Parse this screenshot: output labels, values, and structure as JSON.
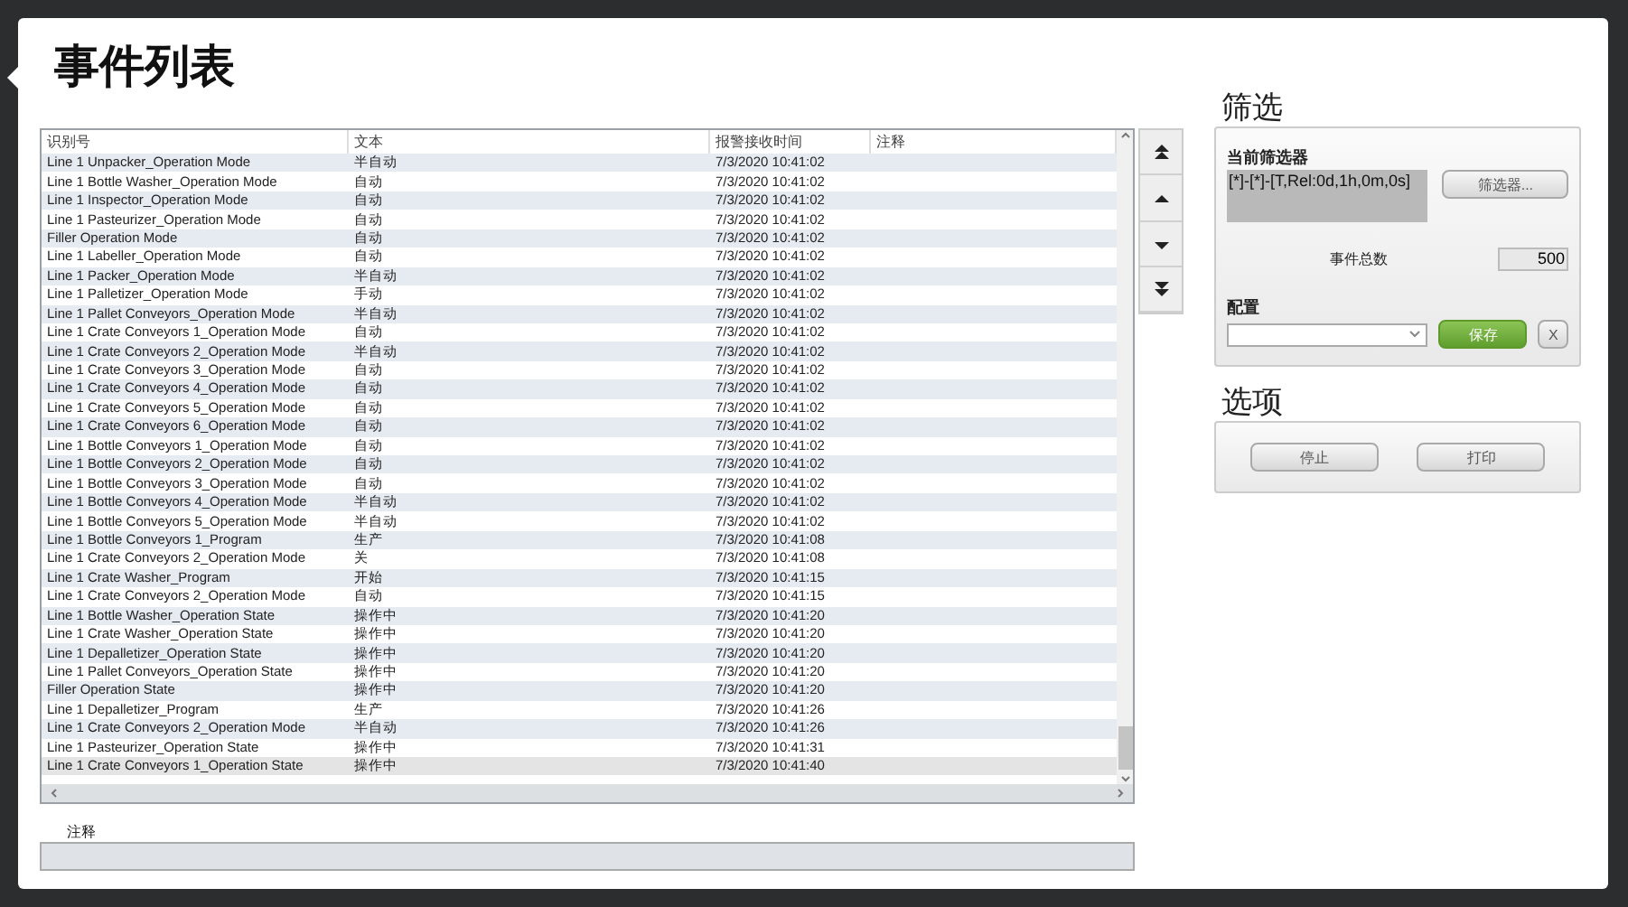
{
  "window": {
    "title": "事件列表"
  },
  "table": {
    "columns": [
      "识别号",
      "文本",
      "报警接收时间",
      "注释"
    ],
    "rows": [
      {
        "id": "Line 1 Unpacker_Operation Mode",
        "text": "半自动",
        "time": "7/3/2020 10:41:02",
        "selected": false
      },
      {
        "id": "Line 1 Bottle Washer_Operation Mode",
        "text": "自动",
        "time": "7/3/2020 10:41:02",
        "selected": false
      },
      {
        "id": "Line 1 Inspector_Operation Mode",
        "text": "自动",
        "time": "7/3/2020 10:41:02",
        "selected": false
      },
      {
        "id": "Line 1 Pasteurizer_Operation Mode",
        "text": "自动",
        "time": "7/3/2020 10:41:02",
        "selected": false
      },
      {
        "id": "Filler Operation Mode",
        "text": "自动",
        "time": "7/3/2020 10:41:02",
        "selected": false
      },
      {
        "id": "Line 1 Labeller_Operation Mode",
        "text": "自动",
        "time": "7/3/2020 10:41:02",
        "selected": false
      },
      {
        "id": "Line 1 Packer_Operation Mode",
        "text": "半自动",
        "time": "7/3/2020 10:41:02",
        "selected": false
      },
      {
        "id": "Line 1 Palletizer_Operation Mode",
        "text": "手动",
        "time": "7/3/2020 10:41:02",
        "selected": false
      },
      {
        "id": "Line 1 Pallet Conveyors_Operation Mode",
        "text": "半自动",
        "time": "7/3/2020 10:41:02",
        "selected": false
      },
      {
        "id": "Line 1 Crate Conveyors 1_Operation Mode",
        "text": "自动",
        "time": "7/3/2020 10:41:02",
        "selected": false
      },
      {
        "id": "Line 1 Crate Conveyors 2_Operation Mode",
        "text": "半自动",
        "time": "7/3/2020 10:41:02",
        "selected": false
      },
      {
        "id": "Line 1 Crate Conveyors 3_Operation Mode",
        "text": "自动",
        "time": "7/3/2020 10:41:02",
        "selected": false
      },
      {
        "id": "Line 1 Crate Conveyors 4_Operation Mode",
        "text": "自动",
        "time": "7/3/2020 10:41:02",
        "selected": false
      },
      {
        "id": "Line 1 Crate Conveyors 5_Operation Mode",
        "text": "自动",
        "time": "7/3/2020 10:41:02",
        "selected": false
      },
      {
        "id": "Line 1 Crate Conveyors 6_Operation Mode",
        "text": "自动",
        "time": "7/3/2020 10:41:02",
        "selected": false
      },
      {
        "id": "Line 1 Bottle Conveyors 1_Operation Mode",
        "text": "自动",
        "time": "7/3/2020 10:41:02",
        "selected": false
      },
      {
        "id": "Line 1 Bottle Conveyors 2_Operation Mode",
        "text": "自动",
        "time": "7/3/2020 10:41:02",
        "selected": false
      },
      {
        "id": "Line 1 Bottle Conveyors 3_Operation Mode",
        "text": "自动",
        "time": "7/3/2020 10:41:02",
        "selected": false
      },
      {
        "id": "Line 1 Bottle Conveyors 4_Operation Mode",
        "text": "半自动",
        "time": "7/3/2020 10:41:02",
        "selected": false
      },
      {
        "id": "Line 1 Bottle Conveyors 5_Operation Mode",
        "text": "半自动",
        "time": "7/3/2020 10:41:02",
        "selected": false
      },
      {
        "id": "Line 1 Bottle Conveyors 1_Program",
        "text": "生产",
        "time": "7/3/2020 10:41:08",
        "selected": false
      },
      {
        "id": "Line 1 Crate Conveyors 2_Operation Mode",
        "text": "关",
        "time": "7/3/2020 10:41:08",
        "selected": false
      },
      {
        "id": "Line 1 Crate Washer_Program",
        "text": "开始",
        "time": "7/3/2020 10:41:15",
        "selected": false
      },
      {
        "id": "Line 1 Crate Conveyors 2_Operation Mode",
        "text": "自动",
        "time": "7/3/2020 10:41:15",
        "selected": false
      },
      {
        "id": "Line 1 Bottle Washer_Operation State",
        "text": "操作中",
        "time": "7/3/2020 10:41:20",
        "selected": false
      },
      {
        "id": "Line 1 Crate Washer_Operation State",
        "text": "操作中",
        "time": "7/3/2020 10:41:20",
        "selected": false
      },
      {
        "id": "Line 1 Depalletizer_Operation State",
        "text": "操作中",
        "time": "7/3/2020 10:41:20",
        "selected": false
      },
      {
        "id": "Line 1 Pallet Conveyors_Operation State",
        "text": "操作中",
        "time": "7/3/2020 10:41:20",
        "selected": false
      },
      {
        "id": "Filler Operation State",
        "text": "操作中",
        "time": "7/3/2020 10:41:20",
        "selected": false
      },
      {
        "id": "Line 1 Depalletizer_Program",
        "text": "生产",
        "time": "7/3/2020 10:41:26",
        "selected": false
      },
      {
        "id": "Line 1 Crate Conveyors 2_Operation Mode",
        "text": "半自动",
        "time": "7/3/2020 10:41:26",
        "selected": false
      },
      {
        "id": "Line 1 Pasteurizer_Operation State",
        "text": "操作中",
        "time": "7/3/2020 10:41:31",
        "selected": false
      },
      {
        "id": "Line 1 Crate Conveyors 1_Operation State",
        "text": "操作中",
        "time": "7/3/2020 10:41:40",
        "selected": true
      }
    ]
  },
  "comment": {
    "label": "注释"
  },
  "filter": {
    "heading": "筛选",
    "current_label": "当前筛选器",
    "current_value": "[*]-[*]-[T,Rel:0d,1h,0m,0s]",
    "filter_button": "筛选器...",
    "total_label": "事件总数",
    "total_value": "500",
    "config_label": "配置",
    "save_button": "保存",
    "clear_button": "X"
  },
  "options": {
    "heading": "选项",
    "buttons": [
      "停止",
      "打印"
    ]
  }
}
